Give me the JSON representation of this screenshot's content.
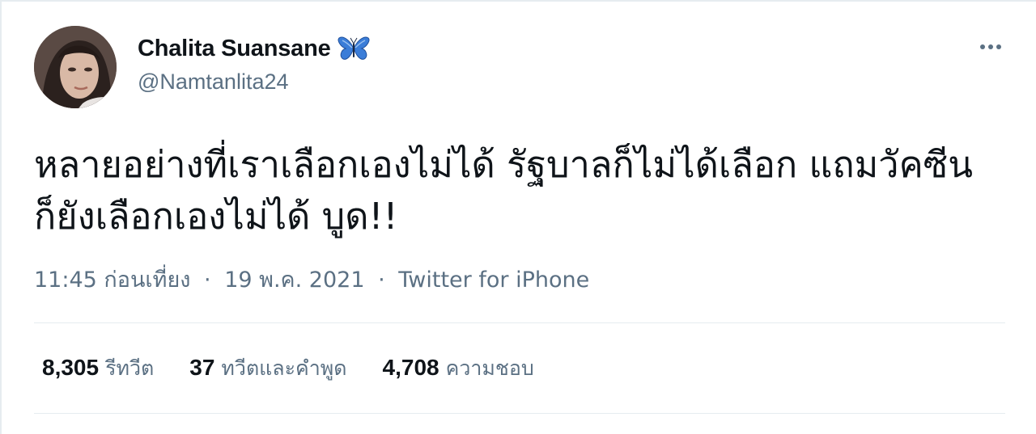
{
  "tweet": {
    "author": {
      "display_name": "Chalita Suansane",
      "handle": "@Namtanlita24",
      "badge_icon": "butterfly-emoji-icon",
      "avatar_icon": "profile-photo"
    },
    "more_icon": "more-options-icon",
    "text_lines": [
      "หลายอย่างที่เราเลือกเองไม่ได้ รัฐบาลก็ไม่ได้เลือก แถมวัคซีน",
      "ก็ยังเลือกเองไม่ได้ บูด!!"
    ],
    "time": "11:45 ก่อนเที่ยง",
    "date": "19 พ.ค. 2021",
    "separator": "·",
    "source": "Twitter for iPhone",
    "stats": [
      {
        "count": "8,305",
        "label": "รีทวีต"
      },
      {
        "count": "37",
        "label": "ทวีตและคำพูด"
      },
      {
        "count": "4,708",
        "label": "ความชอบ"
      }
    ]
  },
  "colors": {
    "text_primary": "#0f1419",
    "text_secondary": "#5b7083",
    "divider": "#e6ecf0",
    "butterfly": "#3b7dd8"
  }
}
